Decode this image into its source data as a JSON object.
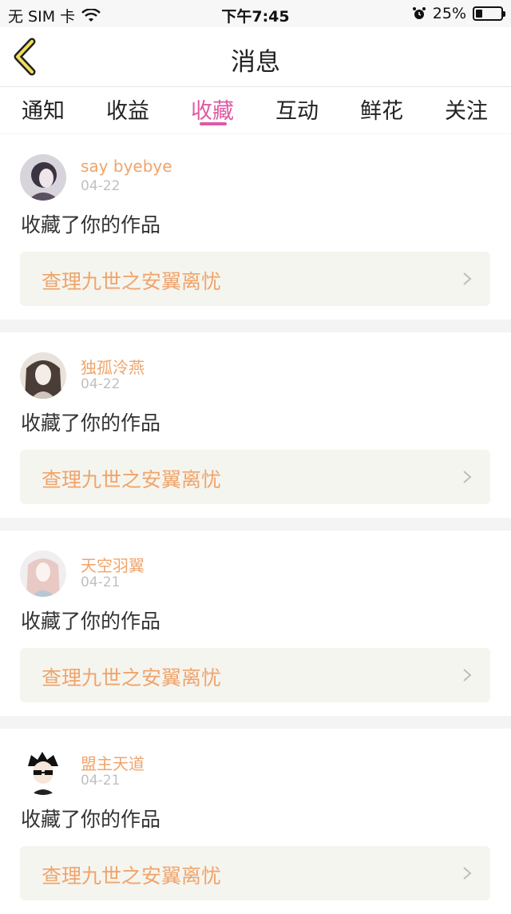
{
  "status_bar": {
    "carrier": "无 SIM 卡",
    "time": "下午7:45",
    "battery": "25%",
    "battery_level": 0.25
  },
  "header": {
    "title": "消息",
    "back_icon": "chevron-left-icon"
  },
  "tabs": [
    {
      "label": "通知",
      "active": false
    },
    {
      "label": "收益",
      "active": false
    },
    {
      "label": "收藏",
      "active": true
    },
    {
      "label": "互动",
      "active": false
    },
    {
      "label": "鲜花",
      "active": false
    },
    {
      "label": "关注",
      "active": false
    }
  ],
  "colors": {
    "accent": "#e05aa3",
    "username": "#f0a46b",
    "work_title": "#f0a46b"
  },
  "messages": [
    {
      "username": "say byebye",
      "date": "04-22",
      "action": "收藏了你的作品",
      "work": "查理九世之安翼离忧"
    },
    {
      "username": "独孤泠燕",
      "date": "04-22",
      "action": "收藏了你的作品",
      "work": "查理九世之安翼离忧"
    },
    {
      "username": "天空羽翼",
      "date": "04-21",
      "action": "收藏了你的作品",
      "work": "查理九世之安翼离忧"
    },
    {
      "username": "盟主天道",
      "date": "04-21",
      "action": "收藏了你的作品",
      "work": "查理九世之安翼离忧"
    }
  ]
}
